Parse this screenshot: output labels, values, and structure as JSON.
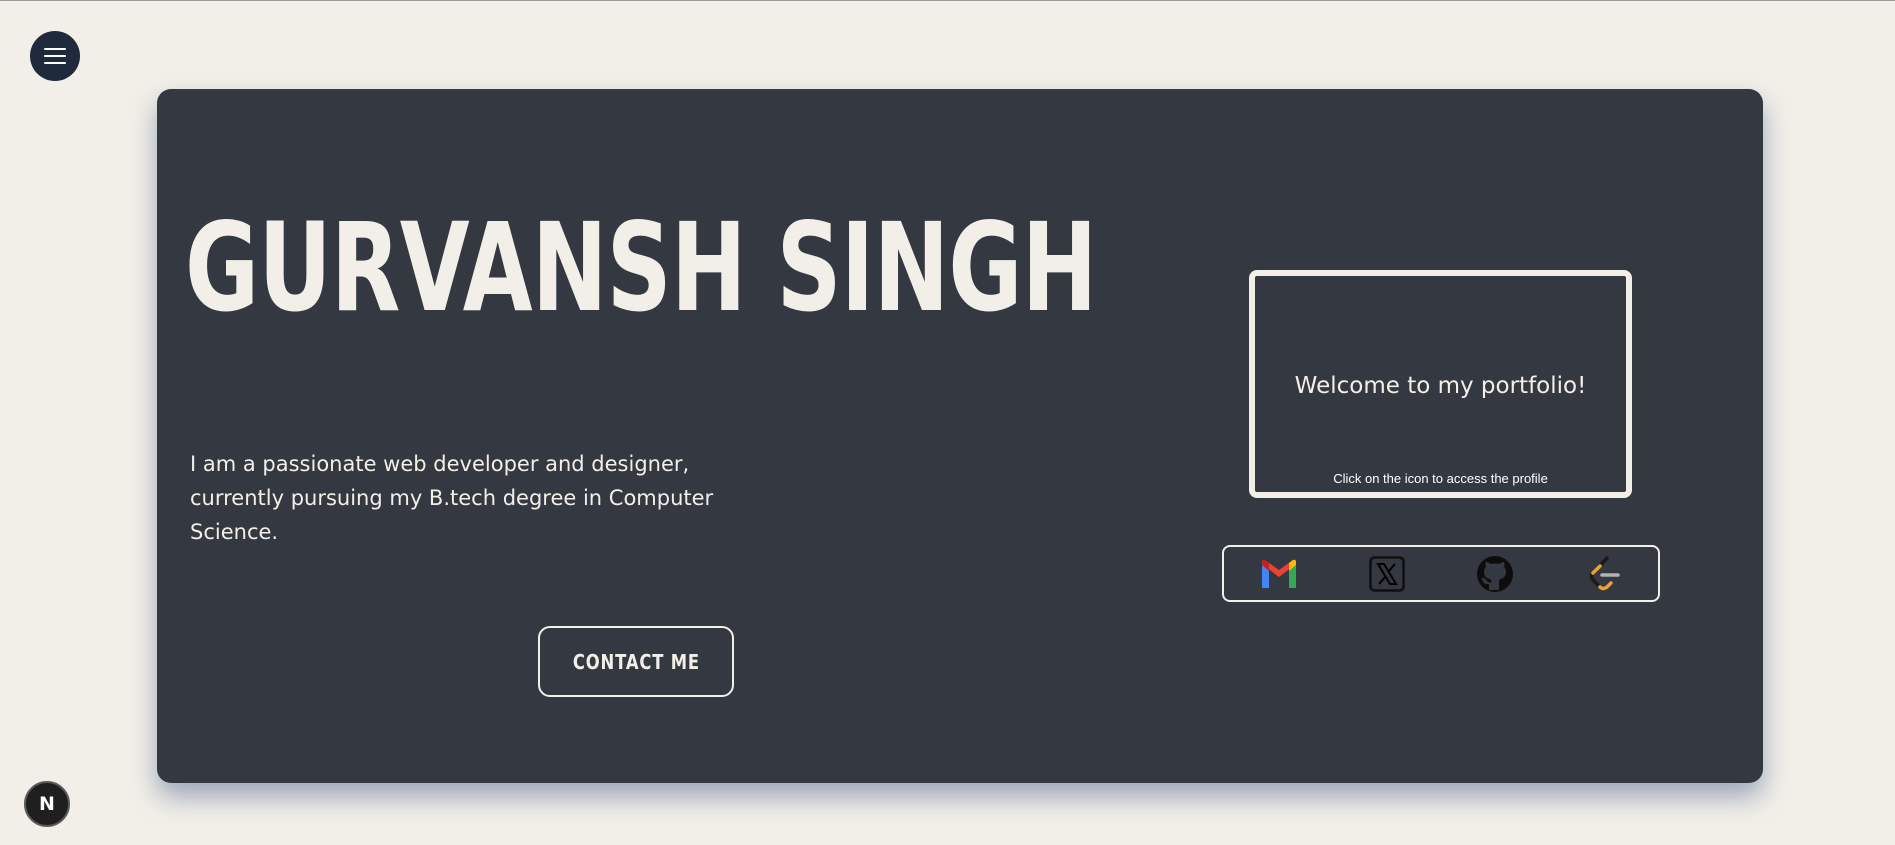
{
  "menu": {
    "icon": "hamburger-menu-icon"
  },
  "hero": {
    "name": "GURVANSH SINGH",
    "bio": "I am a passionate web developer and designer, currently pursuing my B.tech degree in Computer Science.",
    "contact_button": "CONTACT ME"
  },
  "welcome": {
    "title": "Welcome to my portfolio!",
    "note": "Click on the icon to access the profile"
  },
  "social": {
    "icons": [
      "gmail-icon",
      "x-twitter-icon",
      "github-icon",
      "leetcode-icon"
    ]
  },
  "badge": {
    "letter": "N",
    "icon": "nextjs-icon"
  },
  "colors": {
    "page_bg": "#f2efe8",
    "card_bg": "#343841",
    "text_light": "#f2efe8",
    "menu_bg": "#1f2a3c"
  }
}
